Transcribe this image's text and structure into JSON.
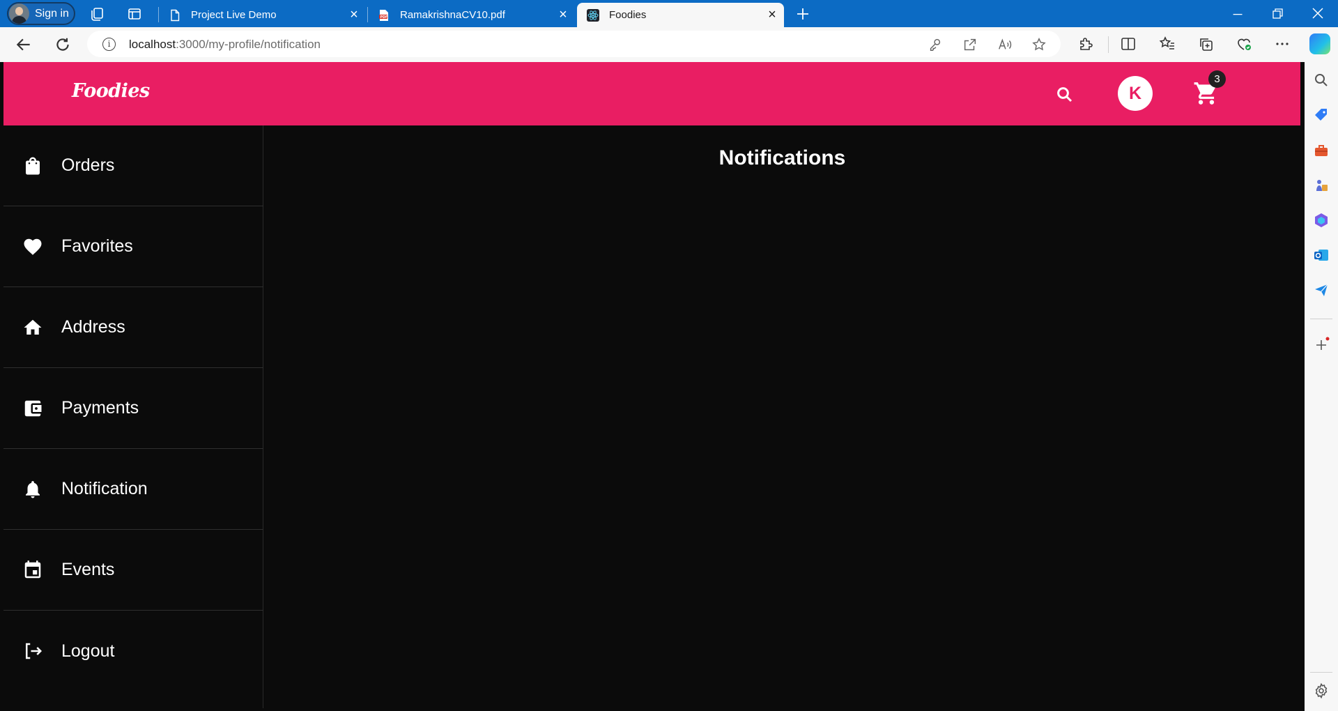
{
  "browser": {
    "signin_label": "Sign in",
    "tabs": [
      {
        "title": "Project Live Demo",
        "icon": "page-icon"
      },
      {
        "title": "RamakrishnaCV10.pdf",
        "icon": "pdf-icon"
      },
      {
        "title": "Foodies",
        "icon": "react-icon"
      }
    ],
    "url_host": "localhost",
    "url_path": ":3000/my-profile/notification"
  },
  "app": {
    "logo": "Foodies",
    "profile_initial": "K",
    "cart_count": "3",
    "accent": "#e91e63"
  },
  "sidebar": {
    "items": [
      {
        "label": "Orders",
        "icon": "shopping-bag-icon"
      },
      {
        "label": "Favorites",
        "icon": "heart-icon"
      },
      {
        "label": "Address",
        "icon": "home-icon"
      },
      {
        "label": "Payments",
        "icon": "wallet-icon"
      },
      {
        "label": "Notification",
        "icon": "bell-icon"
      },
      {
        "label": "Events",
        "icon": "calendar-icon"
      },
      {
        "label": "Logout",
        "icon": "logout-icon"
      }
    ]
  },
  "main": {
    "title": "Notifications"
  }
}
